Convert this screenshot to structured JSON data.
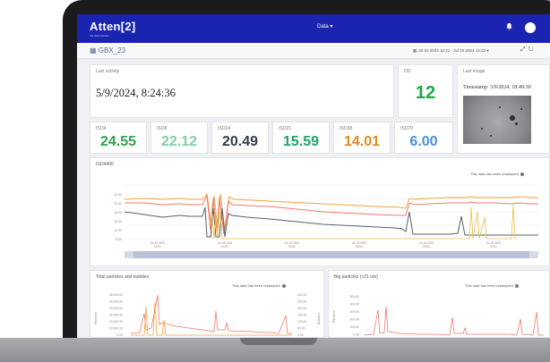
{
  "header": {
    "logo": "Atten[2]",
    "logo_tagline": "the total solution",
    "menu_label": "Data ▾",
    "notification_icon": "bell-icon",
    "toggle_icon": "theme-toggle-icon",
    "brand_color": "#1a24b0"
  },
  "subheader": {
    "device_name": "GBX_23",
    "device_icon": "grid-icon",
    "date_range": "Jul 15 2024 12:21 - Jul 26 2024 12:22 ▾",
    "calendar_icon": "calendar-icon",
    "expand_icon": "expand-icon",
    "refresh_icon": "refresh-icon"
  },
  "cards": {
    "last_activity": {
      "label": "Last activity",
      "value": "5/9/2024, 8:24:36"
    },
    "od": {
      "label": "OD",
      "value": "12",
      "color": "#19a84a"
    },
    "last_image": {
      "label": "Last image",
      "timestamp": "Timestamp: 3/9/2024, 18:49:30"
    }
  },
  "stats": [
    {
      "label": "ISO4",
      "value": "24.55",
      "color": "#2ea24a"
    },
    {
      "label": "ISO6",
      "value": "22.12",
      "color": "#7fd0a4"
    },
    {
      "label": "ISO14",
      "value": "20.49",
      "color": "#2f3e4e"
    },
    {
      "label": "ISO21",
      "value": "15.59",
      "color": "#22a06b"
    },
    {
      "label": "ISO38",
      "value": "14.01",
      "color": "#e08a1e"
    },
    {
      "label": "ISO70",
      "value": "6.00",
      "color": "#4d8fe0"
    }
  ],
  "iso_chart": {
    "title": "ISO4406",
    "resampled_note": "This data has been resampled",
    "y_ticks": [
      "20.00",
      "21.00",
      "18.00",
      "16.00",
      "12.00",
      "8.00"
    ],
    "x_ticks": [
      {
        "d": "Jul 16 2024",
        "t": "00:00"
      },
      {
        "d": "Jul 18 2024",
        "t": "00:00"
      },
      {
        "d": "Jul 20 2024",
        "t": "00:00"
      },
      {
        "d": "Jul 22 2024",
        "t": "00:00"
      },
      {
        "d": "Jul 24 2024",
        "t": "00:00"
      },
      {
        "d": "Jul 26 2024",
        "t": "00:00"
      }
    ],
    "series_colors": [
      "#f2a23a",
      "#ef7b6b",
      "#55606f",
      "#e8c04a"
    ]
  },
  "particles_chart": {
    "title": "Total particles and bubbles",
    "resampled_note": "This data has been resampled",
    "y_ticks": [
      "48,140.00",
      "40,000.00",
      "30,000.00",
      "20,000.00",
      "15,000.00",
      "10,000.00",
      "0.00"
    ],
    "y2_ticks": [
      "300.00",
      "250.00",
      "200.00",
      "150.00",
      "100.00",
      "50.00",
      "0.00"
    ],
    "ylabel": "Particles",
    "y2label": "Bubbles"
  },
  "big_particles_chart": {
    "title": "Big particles (>21 um)",
    "resampled_note": "This data has been resampled",
    "y_ticks": [
      "500.00",
      "400.00",
      "300.00",
      "200.00",
      "100.00",
      "0.00"
    ],
    "ylabel": "Particles"
  }
}
